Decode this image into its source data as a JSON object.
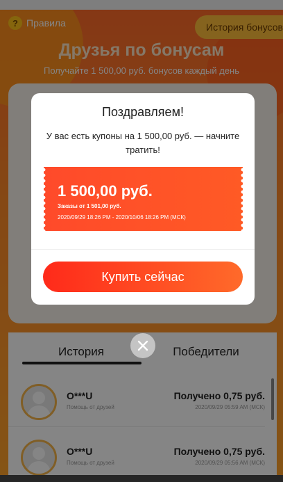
{
  "header": {
    "rules_label": "Правила",
    "help_icon_glyph": "?",
    "history_bonus_label": "История бонусов",
    "title": "Друзья по бонусам",
    "subtitle": "Получайте 1 500,00 руб. бонусов каждый день"
  },
  "tabs": {
    "history": "История",
    "winners": "Победители"
  },
  "rows": [
    {
      "name": "O***U",
      "sub": "Помощь от друзей",
      "amount": "Получено 0,75 руб.",
      "date": "2020/09/29 05:59 AM (МСК)"
    },
    {
      "name": "O***U",
      "sub": "Помощь от друзей",
      "amount": "Получено 0,75 руб.",
      "date": "2020/09/29 05:56 AM (МСК)"
    }
  ],
  "modal": {
    "title": "Поздравляем!",
    "text": "У вас есть купоны на 1 500,00 руб. — начните тратить!",
    "coupon": {
      "amount": "1 500,00 руб.",
      "condition": "Заказы от 1 501,00 руб.",
      "period": "2020/09/29 18:26 PM - 2020/10/06 18:26 PM (МСК)"
    },
    "buy_label": "Купить сейчас",
    "close_icon": "close-icon"
  },
  "colors": {
    "accent": "#ff4a2a",
    "hero": "#ff8a2a",
    "avatar_ring": "#f5b54a"
  }
}
